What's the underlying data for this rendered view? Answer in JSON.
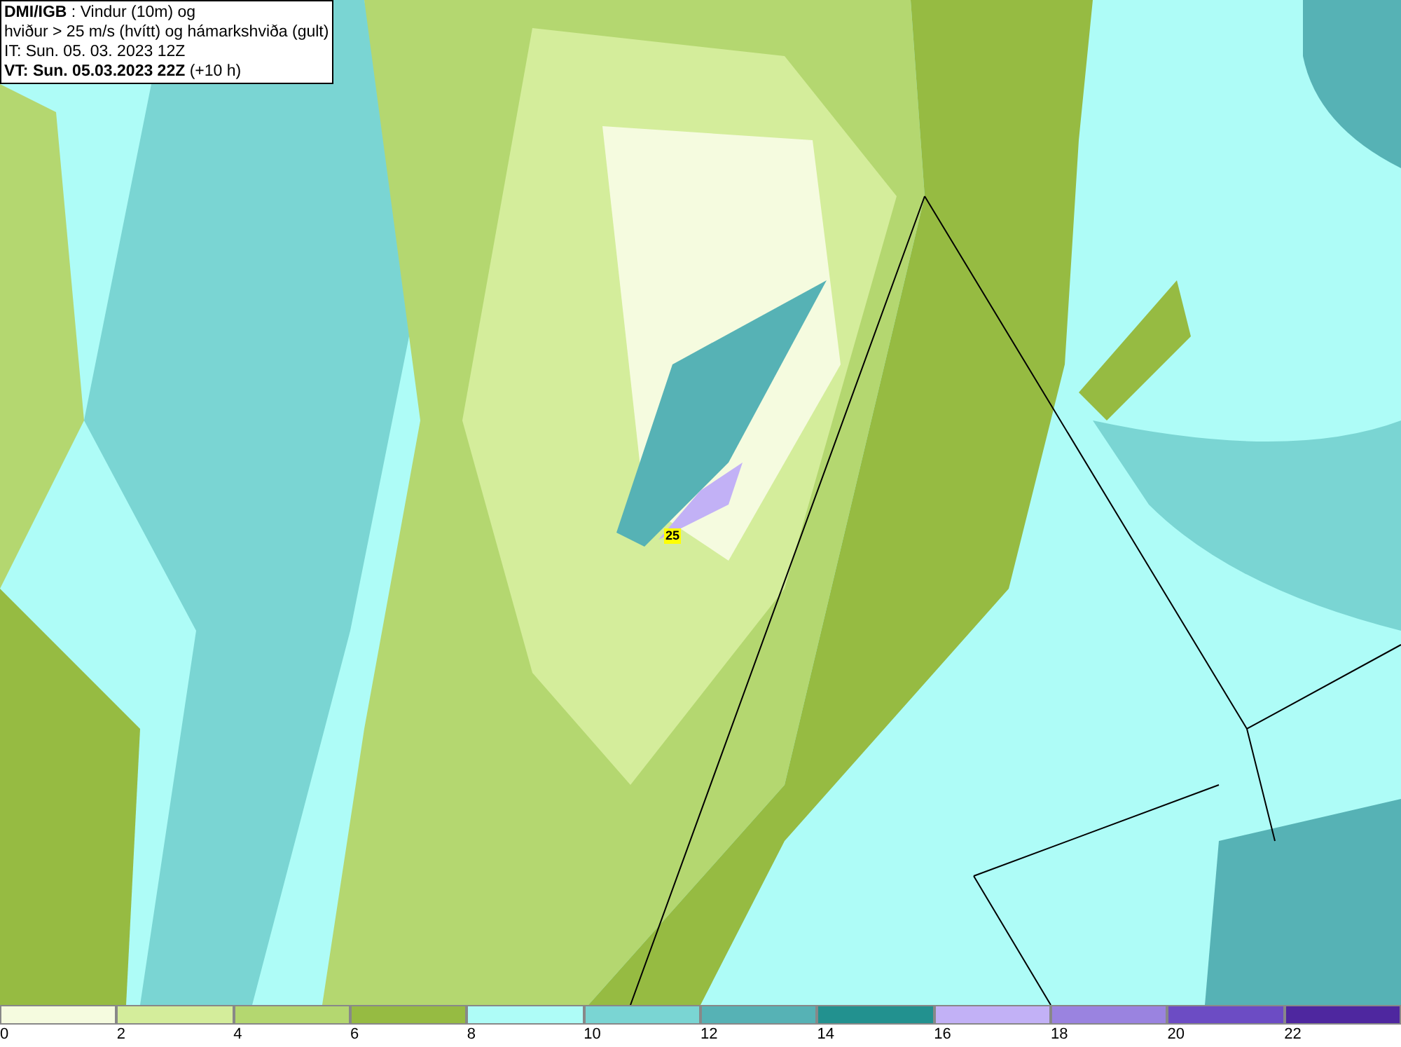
{
  "header": {
    "lines": [
      "**DMI/IGB** : Vindur (10m) og",
      "hviður > 25 m/s (hvítt) og hámarkshviða (gult)",
      "IT: Sun. 05. 03. 2023 12Z",
      "**VT: Sun. 05.03.2023 22Z** (+10 h)"
    ]
  },
  "map": {
    "gust_label": "25"
  },
  "legend": [
    {
      "label": "0",
      "color": "#f5fbdf"
    },
    {
      "label": "2",
      "color": "#d4ed9b"
    },
    {
      "label": "4",
      "color": "#b4d770"
    },
    {
      "label": "6",
      "color": "#96bb42"
    },
    {
      "label": "8",
      "color": "#aefcf7"
    },
    {
      "label": "10",
      "color": "#7ad5d3"
    },
    {
      "label": "12",
      "color": "#56b2b5"
    },
    {
      "label": "14",
      "color": "#22918f"
    },
    {
      "label": "16",
      "color": "#c2b1f6"
    },
    {
      "label": "18",
      "color": "#9a83e0"
    },
    {
      "label": "20",
      "color": "#6c4cc4"
    },
    {
      "label": "22",
      "color": "#4e279f"
    }
  ]
}
